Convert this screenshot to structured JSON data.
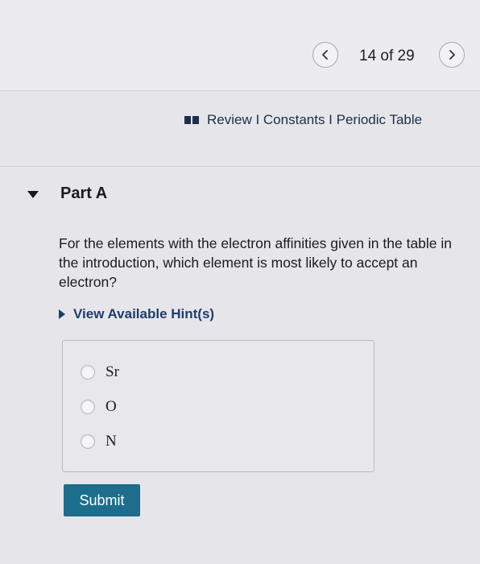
{
  "navigation": {
    "counter": "14 of 29",
    "prev_icon": "chevron-left-icon",
    "next_icon": "chevron-right-icon"
  },
  "resources": {
    "links": "Review I Constants I Periodic Table",
    "icon": "book-icon"
  },
  "part": {
    "title": "Part A",
    "question": "For the elements with the electron affinities given in the table in the introduction, which element is most likely to accept an electron?",
    "hint_label": "View Available Hint(s)"
  },
  "answers": {
    "options": [
      "Sr",
      "O",
      "N"
    ]
  },
  "actions": {
    "submit_label": "Submit"
  },
  "colors": {
    "link": "#1d2f4a",
    "hint": "#1f3d6c",
    "submit_bg": "#1c6e8c"
  }
}
